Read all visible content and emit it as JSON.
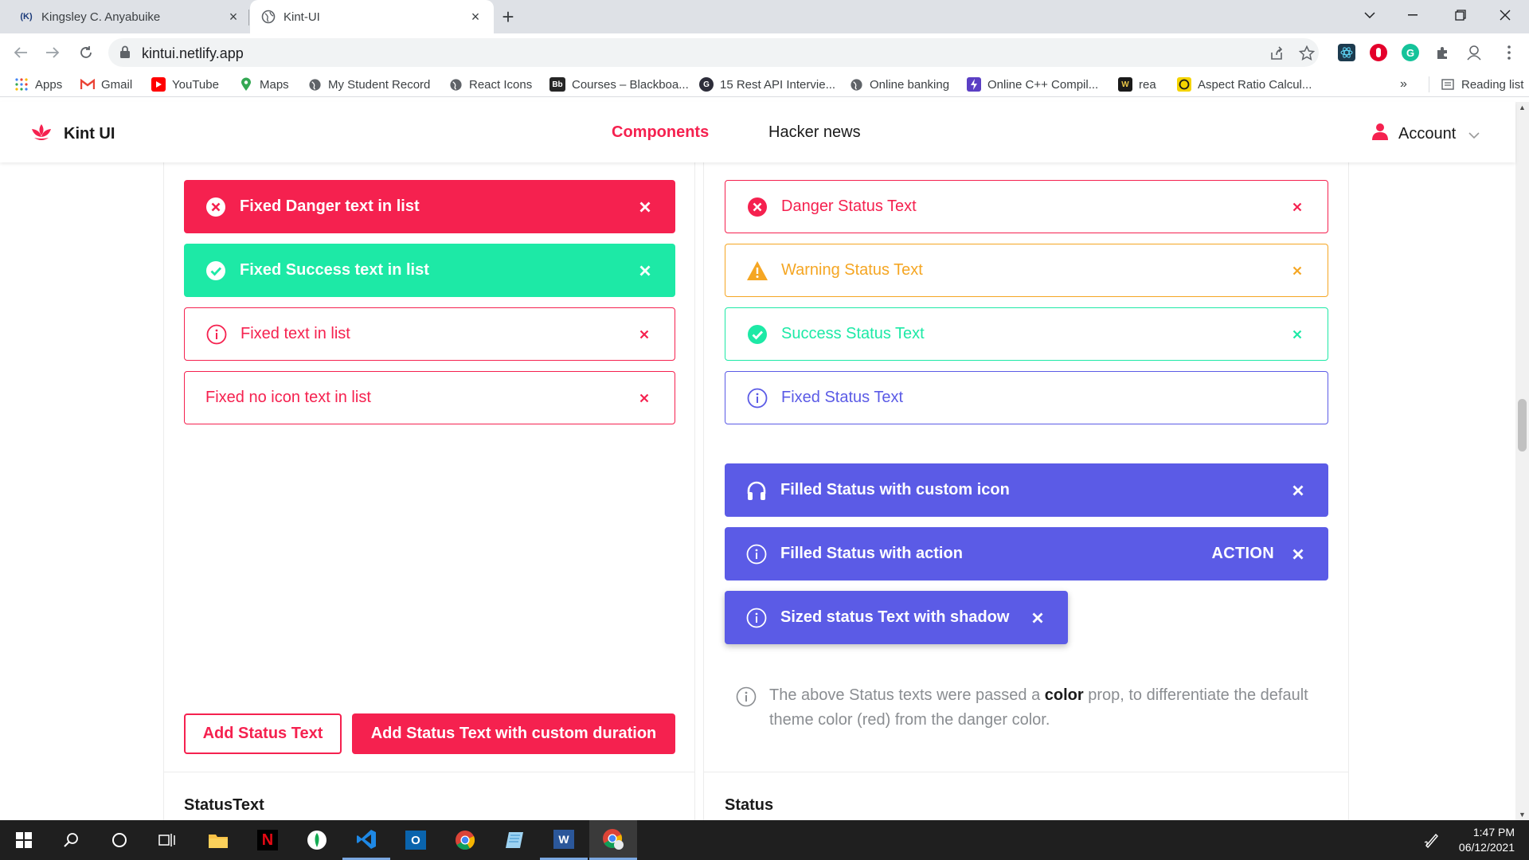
{
  "browser": {
    "tabs": [
      {
        "title": "Kingsley C. Anyabuike",
        "favicon": "(K)"
      },
      {
        "title": "Kint-UI"
      }
    ],
    "url": "kintui.netlify.app",
    "bookmarks": [
      {
        "label": "Apps"
      },
      {
        "label": "Gmail"
      },
      {
        "label": "YouTube"
      },
      {
        "label": "Maps"
      },
      {
        "label": "My Student Record"
      },
      {
        "label": "React Icons"
      },
      {
        "label": "Courses – Blackboa..."
      },
      {
        "label": "15 Rest API Intervie..."
      },
      {
        "label": "Online banking"
      },
      {
        "label": "Online C++ Compil..."
      },
      {
        "label": "rea"
      },
      {
        "label": "Aspect Ratio Calcul..."
      }
    ],
    "bookmarks_overflow": "»",
    "reading_list": "Reading list"
  },
  "app": {
    "brand": "Kint UI",
    "nav": {
      "components": "Components",
      "hacker_news": "Hacker news"
    },
    "account": "Account",
    "colors": {
      "primary": "#f5214f",
      "success": "#1de9a6",
      "warning": "#f5a623",
      "info": "#5b5be6"
    }
  },
  "left": {
    "alerts": [
      {
        "text": "Fixed Danger text in list",
        "icon": "x-circle-icon"
      },
      {
        "text": "Fixed Success text in list",
        "icon": "check-circle-icon"
      },
      {
        "text": "Fixed text in list",
        "icon": "info-icon"
      },
      {
        "text": "Fixed no icon text in list"
      }
    ],
    "buttons": {
      "add": "Add Status Text",
      "add_custom": "Add Status Text with custom duration"
    },
    "section_title": "StatusText"
  },
  "right": {
    "alerts": [
      {
        "text": "Danger Status Text",
        "icon": "x-circle-icon"
      },
      {
        "text": "Warning Status Text",
        "icon": "warning-icon"
      },
      {
        "text": "Success Status Text",
        "icon": "check-circle-icon"
      },
      {
        "text": "Fixed Status Text",
        "icon": "info-icon"
      },
      {
        "text": "Filled Status with custom icon",
        "icon": "headphones-icon"
      },
      {
        "text": "Filled Status with action",
        "icon": "info-icon",
        "action": "ACTION"
      },
      {
        "text": "Sized status Text with shadow",
        "icon": "info-icon"
      }
    ],
    "note": {
      "before": "The above Status texts were passed a ",
      "bold": "color",
      "after": " prop, to differentiate the default theme color (red) from the danger color."
    },
    "section_title": "Status"
  },
  "taskbar": {
    "time": "1:47 PM",
    "date": "06/12/2021"
  }
}
